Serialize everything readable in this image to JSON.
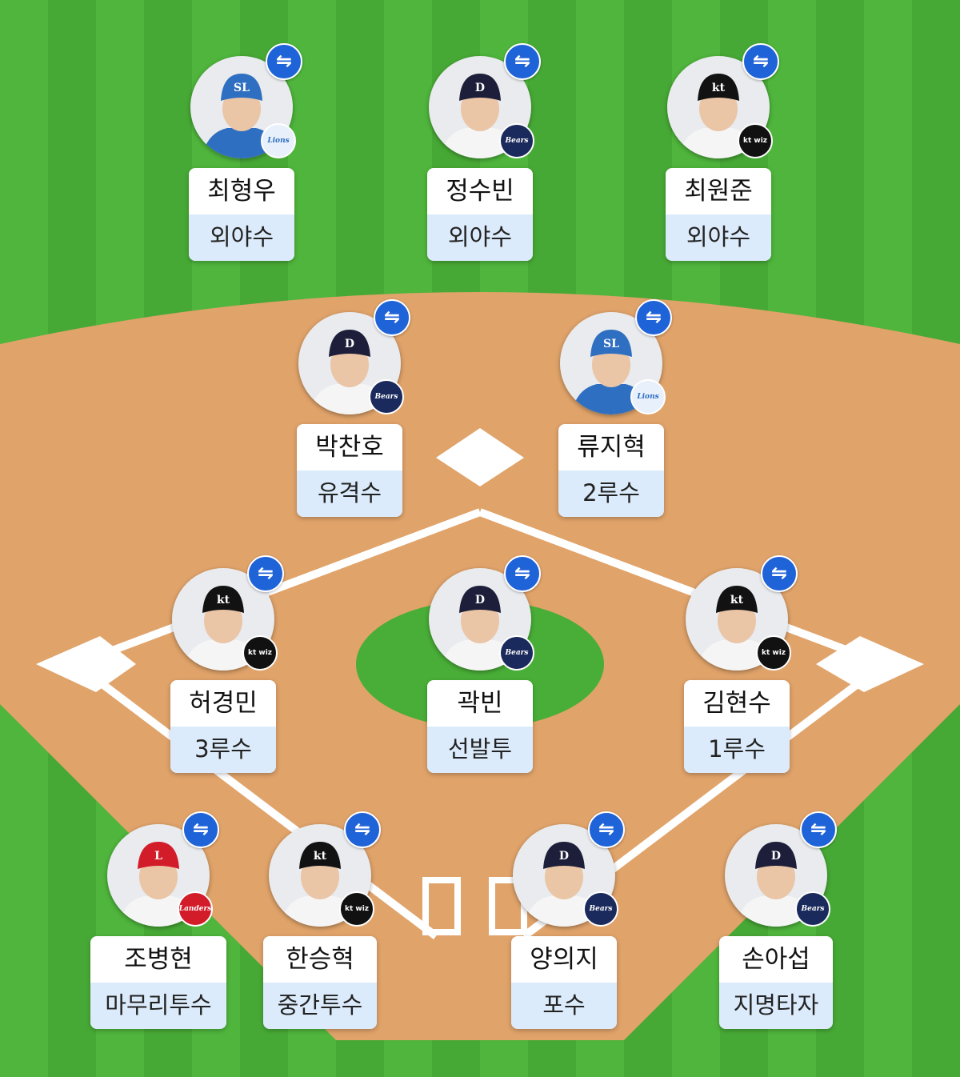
{
  "colors": {
    "grass": "#4eb33b",
    "dirt": "#e0a36a",
    "line": "#ffffff",
    "swap_button": "#1f63d8",
    "position_bg": "#dcebfb"
  },
  "swap_icon": "⇋",
  "players": [
    {
      "id": "lf",
      "name": "최형우",
      "position": "외야수",
      "team": "lions",
      "logo_text": "Lions",
      "cap": "SL",
      "cap_color": "#2f6fc1"
    },
    {
      "id": "cf",
      "name": "정수빈",
      "position": "외야수",
      "team": "bears",
      "logo_text": "Bears",
      "cap": "D",
      "cap_color": "#1d1f3a"
    },
    {
      "id": "rf",
      "name": "최원준",
      "position": "외야수",
      "team": "ktwiz",
      "logo_text": "kt wiz",
      "cap": "kt",
      "cap_color": "#121212"
    },
    {
      "id": "ss",
      "name": "박찬호",
      "position": "유격수",
      "team": "bears",
      "logo_text": "Bears",
      "cap": "D",
      "cap_color": "#1d1f3a"
    },
    {
      "id": "2b",
      "name": "류지혁",
      "position": "2루수",
      "team": "lions",
      "logo_text": "Lions",
      "cap": "SL",
      "cap_color": "#2f6fc1"
    },
    {
      "id": "3b",
      "name": "허경민",
      "position": "3루수",
      "team": "ktwiz",
      "logo_text": "kt wiz",
      "cap": "kt",
      "cap_color": "#121212"
    },
    {
      "id": "sp",
      "name": "곽빈",
      "position": "선발투수",
      "team": "bears",
      "logo_text": "Bears",
      "cap": "D",
      "cap_color": "#1d1f3a"
    },
    {
      "id": "1b",
      "name": "김현수",
      "position": "1루수",
      "team": "ktwiz",
      "logo_text": "kt wiz",
      "cap": "kt",
      "cap_color": "#121212"
    },
    {
      "id": "cp",
      "name": "조병현",
      "position": "마무리투수",
      "team": "landers",
      "logo_text": "Landers",
      "cap": "L",
      "cap_color": "#d31c2a"
    },
    {
      "id": "rp",
      "name": "한승혁",
      "position": "중간투수",
      "team": "ktwiz",
      "logo_text": "kt wiz",
      "cap": "kt",
      "cap_color": "#121212"
    },
    {
      "id": "c",
      "name": "양의지",
      "position": "포수",
      "team": "bears",
      "logo_text": "Bears",
      "cap": "D",
      "cap_color": "#1d1f3a"
    },
    {
      "id": "dh",
      "name": "손아섭",
      "position": "지명타자",
      "team": "bears",
      "logo_text": "Bears",
      "cap": "D",
      "cap_color": "#1d1f3a"
    }
  ]
}
